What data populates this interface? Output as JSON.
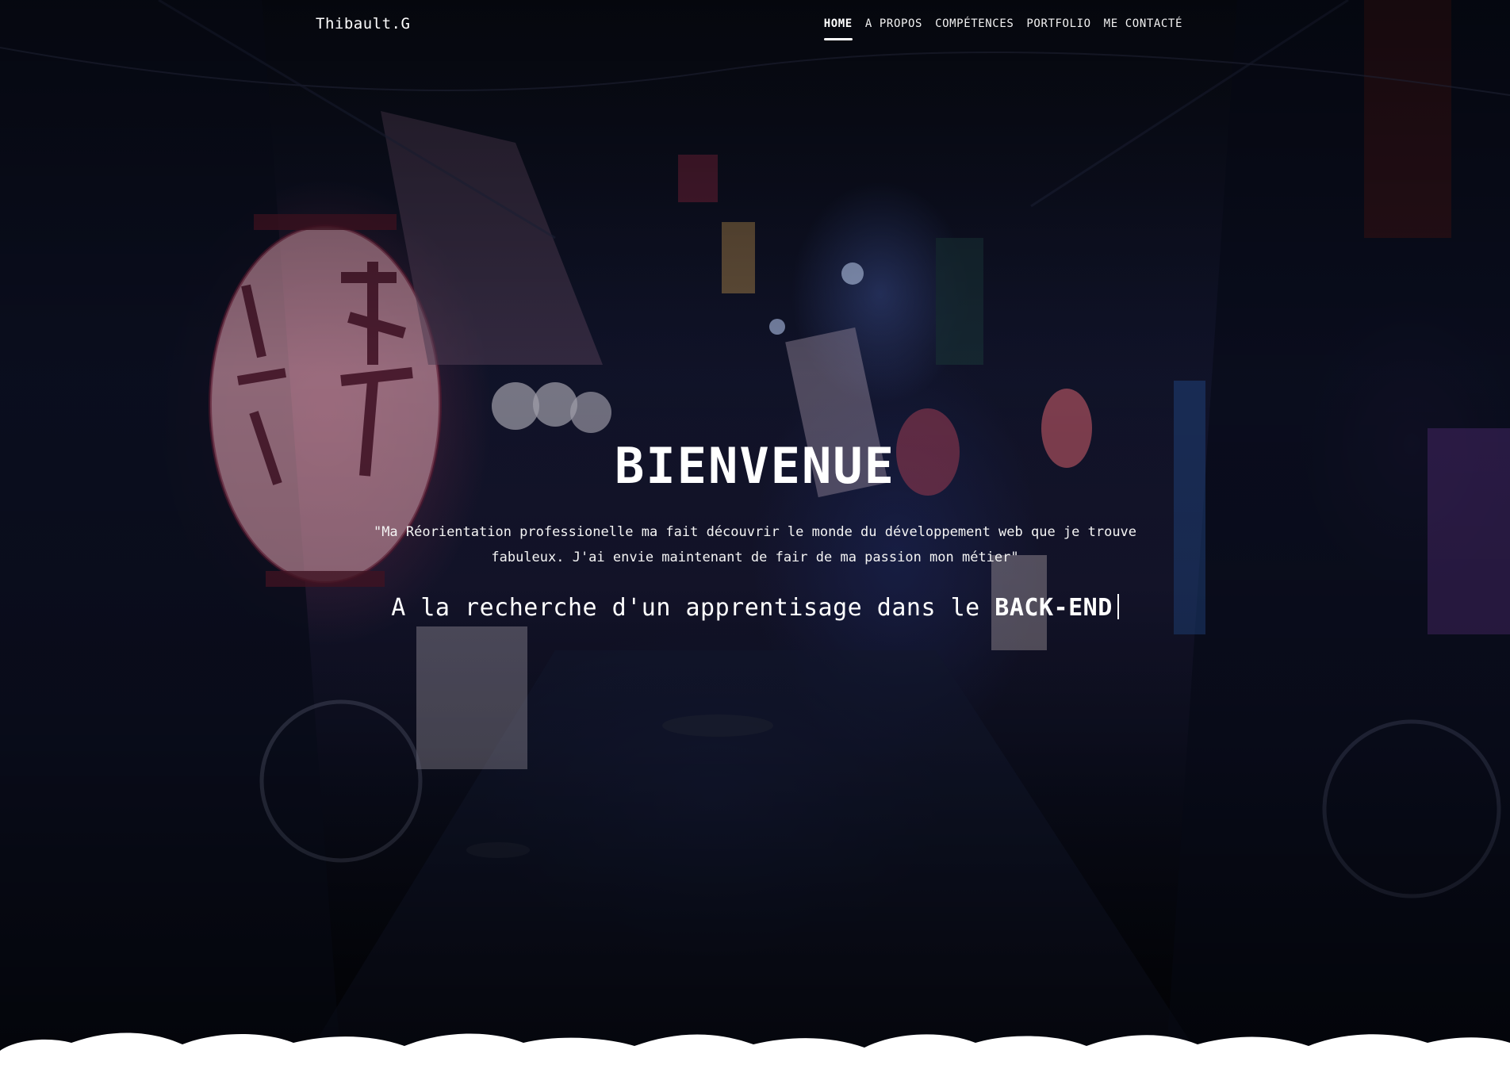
{
  "nav": {
    "brand": "Thibault.G",
    "items": [
      {
        "label": "HOME",
        "active": true
      },
      {
        "label": "A PROPOS",
        "active": false
      },
      {
        "label": "COMPÉTENCES",
        "active": false
      },
      {
        "label": "PORTFOLIO",
        "active": false
      },
      {
        "label": "ME CONTACTÉ",
        "active": false
      }
    ]
  },
  "hero": {
    "title": "BIENVENUE",
    "quote": "\"Ma Réorientation professionelle ma fait découvrir le monde du développement web que je trouve fabuleux. J'ai envie maintenant de fair de ma passion mon métier\"",
    "typed_prefix": "A la recherche d'un apprentisage dans le",
    "typed_word": "BACK-END"
  },
  "colors": {
    "text": "#ffffff",
    "accent_lantern": "#c8466e",
    "accent_neon_blue": "#5a78dc"
  }
}
